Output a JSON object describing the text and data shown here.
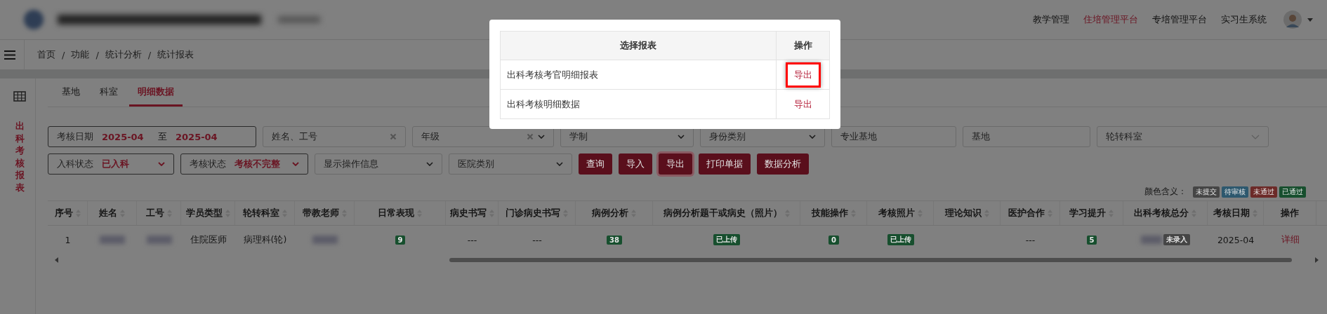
{
  "header": {
    "nav": [
      {
        "label": "教学管理",
        "selected": false
      },
      {
        "label": "住培管理平台",
        "selected": true
      },
      {
        "label": "专培管理平台",
        "selected": false
      },
      {
        "label": "实习生系统",
        "selected": false
      }
    ]
  },
  "breadcrumb": [
    {
      "label": "首页"
    },
    {
      "sep": "/",
      "label": "功能"
    },
    {
      "sep": "/",
      "label": "统计分析"
    },
    {
      "sep": "/",
      "label": "统计报表"
    }
  ],
  "sidebar": {
    "title": "出科考核报表"
  },
  "tabs": [
    {
      "label": "基地",
      "selected": false
    },
    {
      "label": "科室",
      "selected": false
    },
    {
      "label": "明细数据",
      "selected": true
    }
  ],
  "filters": [
    [
      {
        "kind": "daterange",
        "label": "考核日期",
        "from": "2025-04",
        "sep": "至",
        "to": "2025-04"
      },
      {
        "kind": "input",
        "placeholder": "姓名、工号",
        "clearable": true
      },
      {
        "kind": "select",
        "placeholder": "年级",
        "clearable": true
      },
      {
        "kind": "select",
        "placeholder": "学制",
        "clearable": false
      },
      {
        "kind": "select",
        "placeholder": "身份类别",
        "clearable": false
      },
      {
        "kind": "input",
        "placeholder": "专业基地",
        "clearable": false
      },
      {
        "kind": "input",
        "placeholder": "基地",
        "clearable": false
      },
      {
        "kind": "multiselect",
        "placeholder": "轮转科室",
        "clearable": false
      }
    ],
    [
      {
        "kind": "labeled",
        "label": "入科状态",
        "value": "已入科"
      },
      {
        "kind": "labeled",
        "label": "考核状态",
        "value": "考核不完整"
      },
      {
        "kind": "select",
        "placeholder": "显示操作信息",
        "clearable": false
      },
      {
        "kind": "select",
        "placeholder": "医院类别",
        "clearable": false
      }
    ]
  ],
  "buttons": [
    {
      "label": "查询",
      "focused": false
    },
    {
      "label": "导入",
      "focused": false
    },
    {
      "label": "导出",
      "focused": true
    },
    {
      "label": "打印单据",
      "focused": false
    },
    {
      "label": "数据分析",
      "focused": false
    }
  ],
  "legend": {
    "label": "颜色含义：",
    "items": [
      {
        "label": "未提交",
        "color": "#454545"
      },
      {
        "label": "待审核",
        "color": "#2d586e"
      },
      {
        "label": "未通过",
        "color": "#6c2a28"
      },
      {
        "label": "已通过",
        "color": "#174f2e"
      }
    ]
  },
  "table": {
    "columns": [
      {
        "label": "序号",
        "sortable": true
      },
      {
        "label": "姓名",
        "sortable": true
      },
      {
        "label": "工号",
        "sortable": true
      },
      {
        "label": "学员类型",
        "sortable": true
      },
      {
        "label": "轮转科室",
        "sortable": true
      },
      {
        "label": "带教老师",
        "sortable": true
      },
      {
        "label": "日常表现",
        "sortable": true
      },
      {
        "label": "病史书写",
        "sortable": true
      },
      {
        "label": "门诊病史书写",
        "sortable": true
      },
      {
        "label": "病例分析",
        "sortable": true
      },
      {
        "label": "病例分析题干或病史（照片）",
        "sortable": true
      },
      {
        "label": "技能操作",
        "sortable": true
      },
      {
        "label": "考核照片",
        "sortable": true
      },
      {
        "label": "理论知识",
        "sortable": true
      },
      {
        "label": "医护合作",
        "sortable": true
      },
      {
        "label": "学习提升",
        "sortable": true
      },
      {
        "label": "出科考核总分",
        "sortable": true
      },
      {
        "label": "考核日期",
        "sortable": true
      },
      {
        "label": "操作",
        "sortable": false
      }
    ],
    "rows": [
      [
        {
          "kind": "text",
          "text": "1"
        },
        {
          "kind": "blurred"
        },
        {
          "kind": "blurred"
        },
        {
          "kind": "text",
          "text": "住院医师"
        },
        {
          "kind": "text",
          "text": "病理科(轮)"
        },
        {
          "kind": "blurred"
        },
        {
          "kind": "badge",
          "text": "9",
          "color": "#174f2e"
        },
        {
          "kind": "text",
          "text": "---"
        },
        {
          "kind": "text",
          "text": "---"
        },
        {
          "kind": "badge",
          "text": "38",
          "color": "#174f2e"
        },
        {
          "kind": "badge",
          "text": "已上传",
          "color": "#174f2e"
        },
        {
          "kind": "badge",
          "text": "0",
          "color": "#174f2e"
        },
        {
          "kind": "badge",
          "text": "已上传",
          "color": "#174f2e"
        },
        {
          "kind": "empty"
        },
        {
          "kind": "text",
          "text": "---"
        },
        {
          "kind": "badge",
          "text": "5",
          "color": "#174f2e"
        },
        {
          "kind": "blurbadge",
          "text": "未录入",
          "color": "#454545"
        },
        {
          "kind": "text",
          "text": "2025-04"
        },
        {
          "kind": "link",
          "text": "详细"
        }
      ]
    ]
  },
  "modal": {
    "columns": [
      "选择报表",
      "操作"
    ],
    "rows": [
      {
        "name": "出科考核考官明细报表",
        "action": "导出",
        "highlighted": true
      },
      {
        "name": "出科考核明细数据",
        "action": "导出",
        "highlighted": false
      }
    ]
  }
}
